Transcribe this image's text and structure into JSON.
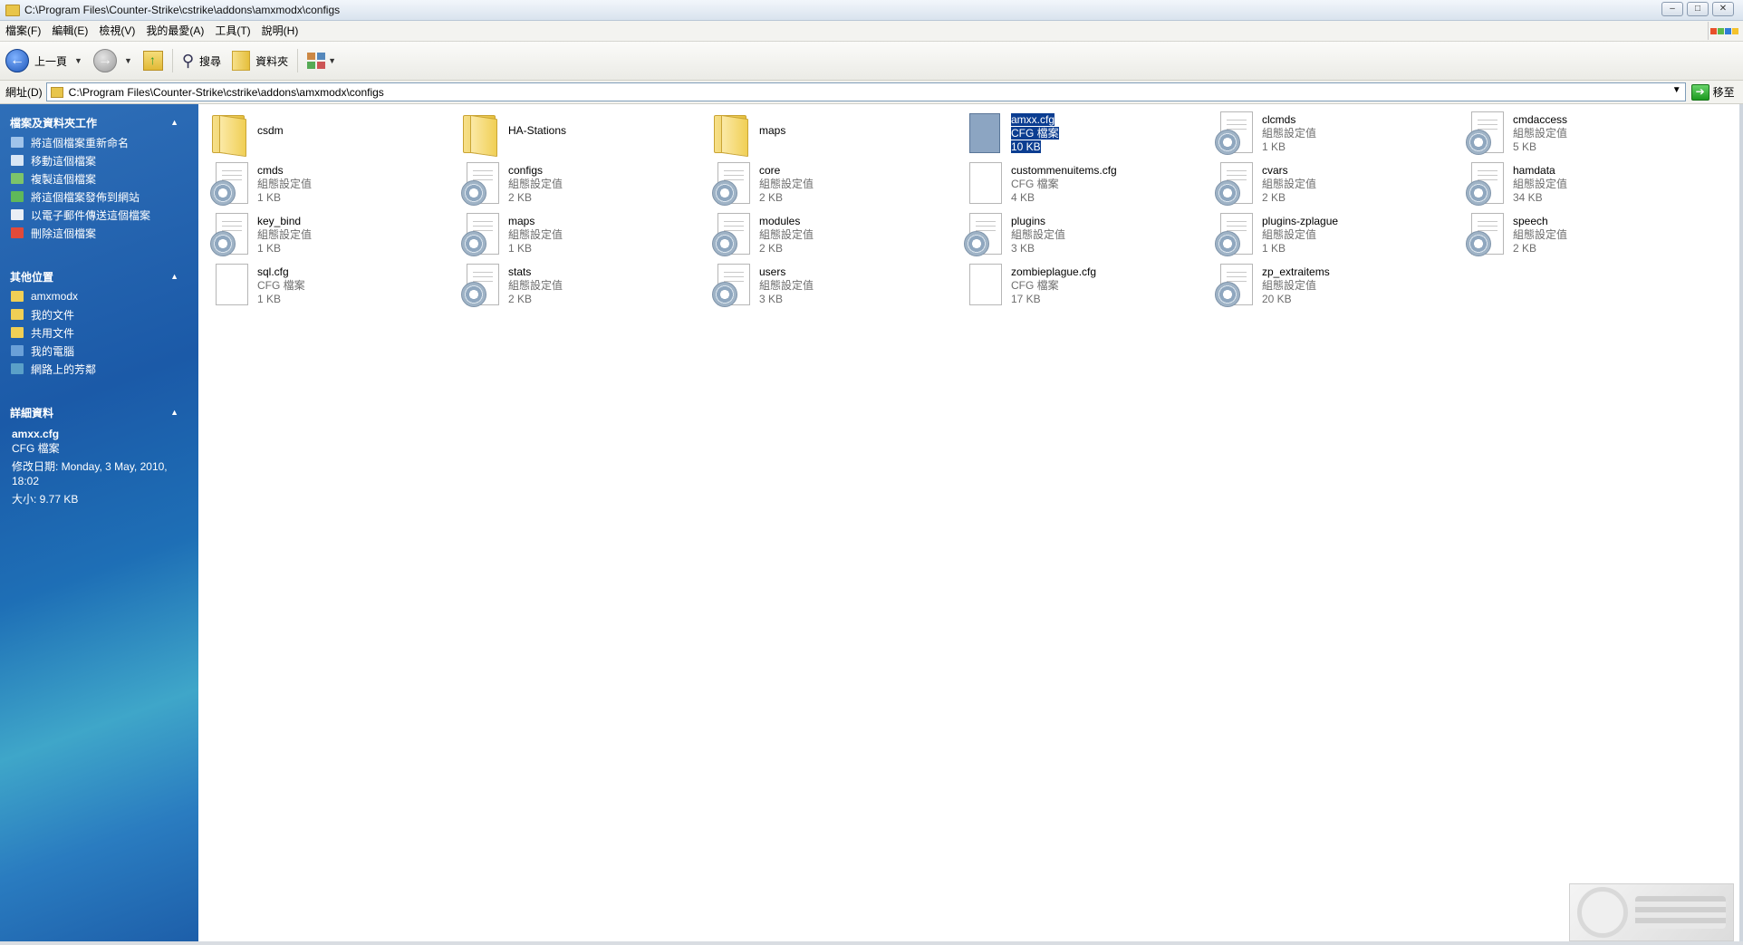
{
  "window": {
    "title": "C:\\Program Files\\Counter-Strike\\cstrike\\addons\\amxmodx\\configs",
    "controls": [
      "–",
      "□",
      "✕"
    ]
  },
  "menu": [
    "檔案(F)",
    "編輯(E)",
    "檢視(V)",
    "我的最愛(A)",
    "工具(T)",
    "說明(H)"
  ],
  "toolbar": {
    "back_label": "上一頁",
    "search_label": "搜尋",
    "folders_label": "資料夾"
  },
  "address": {
    "label": "網址(D)",
    "value": "C:\\Program Files\\Counter-Strike\\cstrike\\addons\\amxmodx\\configs",
    "go_label": "移至"
  },
  "sidebar": {
    "tasks_header": "檔案及資料夾工作",
    "tasks": [
      {
        "label": "將這個檔案重新命名",
        "icon": "rename-icon",
        "color": "#9fc3ea"
      },
      {
        "label": "移動這個檔案",
        "icon": "move-icon",
        "color": "#d8e6f5"
      },
      {
        "label": "複製這個檔案",
        "icon": "copy-icon",
        "color": "#7cc46a"
      },
      {
        "label": "將這個檔案發佈到網站",
        "icon": "publish-icon",
        "color": "#5fb85a"
      },
      {
        "label": "以電子郵件傳送這個檔案",
        "icon": "email-icon",
        "color": "#e9eef5"
      },
      {
        "label": "刪除這個檔案",
        "icon": "delete-icon",
        "color": "#e14a3a"
      }
    ],
    "places_header": "其他位置",
    "places": [
      {
        "label": "amxmodx",
        "icon": "folder-icon",
        "color": "#f0cf55"
      },
      {
        "label": "我的文件",
        "icon": "my-documents-icon",
        "color": "#f0cf55"
      },
      {
        "label": "共用文件",
        "icon": "shared-documents-icon",
        "color": "#f0cf55"
      },
      {
        "label": "我的電腦",
        "icon": "my-computer-icon",
        "color": "#6aa0d8"
      },
      {
        "label": "網路上的芳鄰",
        "icon": "network-icon",
        "color": "#5aa0c8"
      }
    ],
    "details_header": "詳細資料",
    "details": {
      "name": "amxx.cfg",
      "type": "CFG 檔案",
      "modified_1": "修改日期: Monday, 3 May, 2010,",
      "modified_2": "18:02",
      "size": "大小: 9.77 KB"
    }
  },
  "files": [
    {
      "name": "csdm",
      "kind": "folder"
    },
    {
      "name": "HA-Stations",
      "kind": "folder"
    },
    {
      "name": "maps",
      "kind": "folder"
    },
    {
      "name": "amxx.cfg",
      "type": "CFG 檔案",
      "size": "10 KB",
      "kind": "selected"
    },
    {
      "name": "clcmds",
      "type": "組態設定值",
      "size": "1 KB",
      "kind": "config"
    },
    {
      "name": "cmdaccess",
      "type": "組態設定值",
      "size": "5 KB",
      "kind": "config"
    },
    {
      "name": "cmds",
      "type": "組態設定值",
      "size": "1 KB",
      "kind": "config"
    },
    {
      "name": "configs",
      "type": "組態設定值",
      "size": "2 KB",
      "kind": "config"
    },
    {
      "name": "core",
      "type": "組態設定值",
      "size": "2 KB",
      "kind": "config"
    },
    {
      "name": "custommenuitems.cfg",
      "type": "CFG 檔案",
      "size": "4 KB",
      "kind": "file"
    },
    {
      "name": "cvars",
      "type": "組態設定值",
      "size": "2 KB",
      "kind": "config"
    },
    {
      "name": "hamdata",
      "type": "組態設定值",
      "size": "34 KB",
      "kind": "config"
    },
    {
      "name": "key_bind",
      "type": "組態設定值",
      "size": "1 KB",
      "kind": "config"
    },
    {
      "name": "maps",
      "type": "組態設定值",
      "size": "1 KB",
      "kind": "config"
    },
    {
      "name": "modules",
      "type": "組態設定值",
      "size": "2 KB",
      "kind": "config"
    },
    {
      "name": "plugins",
      "type": "組態設定值",
      "size": "3 KB",
      "kind": "config"
    },
    {
      "name": "plugins-zplague",
      "type": "組態設定值",
      "size": "1 KB",
      "kind": "config"
    },
    {
      "name": "speech",
      "type": "組態設定值",
      "size": "2 KB",
      "kind": "config"
    },
    {
      "name": "sql.cfg",
      "type": "CFG 檔案",
      "size": "1 KB",
      "kind": "file"
    },
    {
      "name": "stats",
      "type": "組態設定值",
      "size": "2 KB",
      "kind": "config"
    },
    {
      "name": "users",
      "type": "組態設定值",
      "size": "3 KB",
      "kind": "config"
    },
    {
      "name": "zombieplague.cfg",
      "type": "CFG 檔案",
      "size": "17 KB",
      "kind": "file"
    },
    {
      "name": "zp_extraitems",
      "type": "組態設定值",
      "size": "20 KB",
      "kind": "config"
    }
  ]
}
